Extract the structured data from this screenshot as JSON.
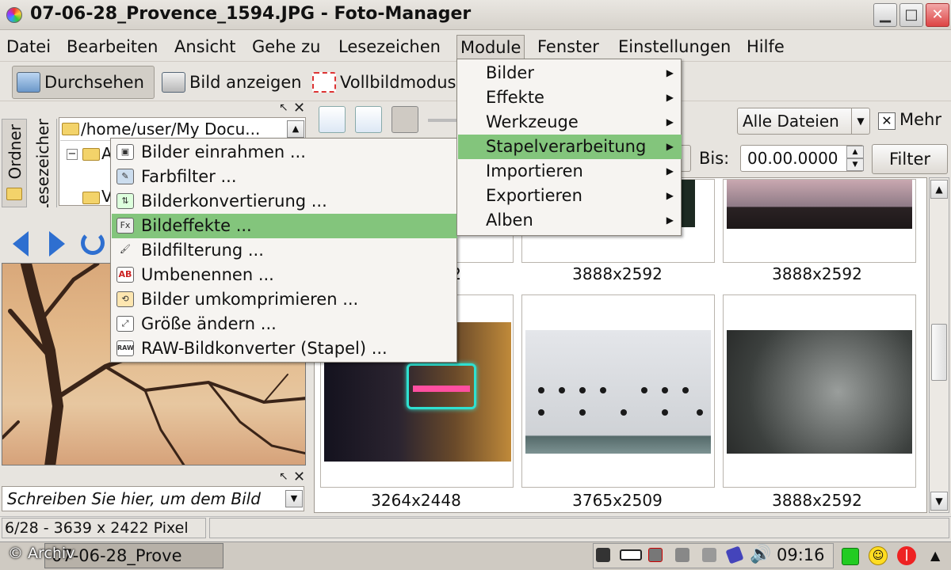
{
  "window": {
    "title": "07-06-28_Provence_1594.JPG - Foto-Manager"
  },
  "menubar": {
    "items": [
      "Datei",
      "Bearbeiten",
      "Ansicht",
      "Gehe zu",
      "Lesezeichen",
      "Module",
      "Fenster",
      "Einstellungen",
      "Hilfe"
    ]
  },
  "toolbar": {
    "browse": "Durchsehen",
    "view_image": "Bild anzeigen",
    "fullscreen": "Vollbildmodus"
  },
  "sidebar": {
    "tab_folders": "Ordner",
    "tab_bookmarks": "Lesezeichen",
    "path": "/home/user/My Docu...",
    "tree_partial_1": "A",
    "tree_partial_2": "V"
  },
  "comment": {
    "placeholder": "Schreiben Sie hier, um dem Bild"
  },
  "filter": {
    "type_value": "Alle Dateien",
    "more_label": "Mehr",
    "more_checked": true,
    "bis_label": "Bis:",
    "date_value": "00.00.0000",
    "button": "Filter"
  },
  "thumbnails": [
    {
      "label": "3888x2592",
      "icon": "thumb-partial"
    },
    {
      "label": "3888x2592",
      "icon": "thumb-city-dusk"
    },
    {
      "label": "3264x2448",
      "icon": "thumb-neon-sign"
    },
    {
      "label": "3765x2509",
      "icon": "thumb-ship-hull"
    },
    {
      "label": "3888x2592",
      "icon": "thumb-water-foam"
    }
  ],
  "thumb_partial_label": "2",
  "status": {
    "text": "6/28 - 3639 x 2422 Pixel"
  },
  "taskbar": {
    "task": "07-06-28_Prove",
    "clock": "09:16",
    "copyright": "© Archiv"
  },
  "module_menu": {
    "items": [
      "Bilder",
      "Effekte",
      "Werkzeuge",
      "Stapelverarbeitung",
      "Importieren",
      "Exportieren",
      "Alben"
    ],
    "highlighted": "Stapelverarbeitung"
  },
  "batch_menu": {
    "items": [
      {
        "label": "Bilder einrahmen ...",
        "icon": "frame-icon"
      },
      {
        "label": "Farbfilter ...",
        "icon": "color-filter-icon"
      },
      {
        "label": "Bilderkonvertierung ...",
        "icon": "convert-icon"
      },
      {
        "label": "Bildeffekte ...",
        "icon": "fx-icon"
      },
      {
        "label": "Bildfilterung ...",
        "icon": "filter-brush-icon"
      },
      {
        "label": "Umbenennen ...",
        "icon": "rename-icon"
      },
      {
        "label": "Bilder umkomprimieren ...",
        "icon": "recompress-icon"
      },
      {
        "label": "Größe ändern ...",
        "icon": "resize-icon"
      },
      {
        "label": "RAW-Bildkonverter (Stapel) ...",
        "icon": "raw-icon"
      }
    ],
    "highlighted": "Bildeffekte ...",
    "fx_glyph": "Fx",
    "raw_glyph": "RAW"
  },
  "colors": {
    "highlight": "#83c57c",
    "panel": "#e7e4df"
  }
}
